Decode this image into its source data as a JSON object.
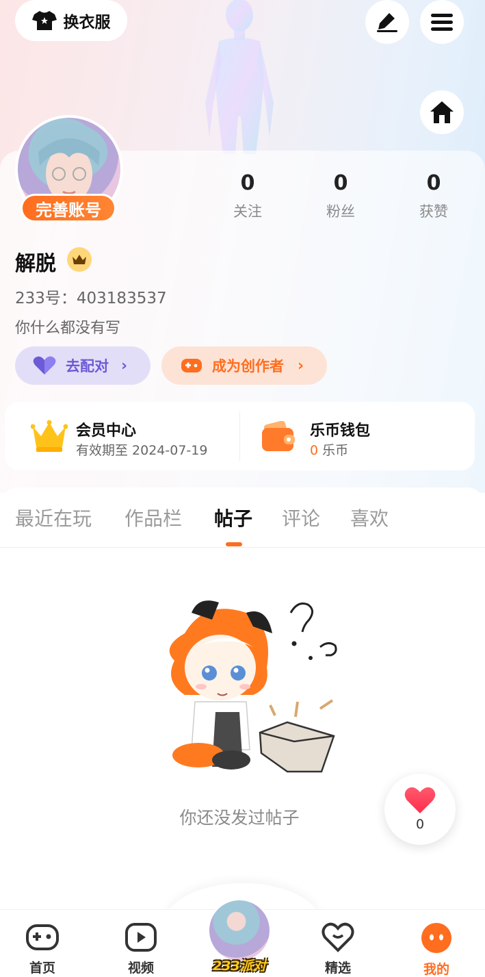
{
  "header": {
    "change_outfit_label": "换衣服",
    "edit_icon": "pen-icon",
    "menu_icon": "hamburger-icon",
    "home_icon": "home-icon"
  },
  "profile": {
    "complete_account_label": "完善账号",
    "username": "解脱",
    "uid_text": "233号：403183537",
    "bio": "你什么都没有写",
    "stats": [
      {
        "value": "0",
        "label": "关注"
      },
      {
        "value": "0",
        "label": "粉丝"
      },
      {
        "value": "0",
        "label": "获赞"
      }
    ]
  },
  "actions": {
    "match_label": "去配对",
    "creator_label": "成为创作者"
  },
  "membership": {
    "member_title": "会员中心",
    "member_sub": "有效期至 2024-07-19",
    "wallet_title": "乐币钱包",
    "wallet_amount": "0",
    "wallet_unit": "乐币"
  },
  "tabs": [
    "最近在玩",
    "作品栏",
    "帖子",
    "评论",
    "喜欢"
  ],
  "active_tab": "帖子",
  "empty_state": {
    "text": "你还没发过帖子"
  },
  "like_float": {
    "count": "0"
  },
  "bottom_nav": {
    "items": [
      {
        "label": "首页",
        "icon": "gamepad-icon"
      },
      {
        "label": "视频",
        "icon": "play-icon"
      },
      {
        "label": "精选",
        "icon": "heart-chat-icon"
      },
      {
        "label": "我的",
        "icon": "face-icon"
      }
    ],
    "center_logo": "233派对"
  },
  "colors": {
    "accent": "#ff6d1f",
    "purple": "#6b5bd6",
    "orange_text": "#ff6d1f"
  }
}
